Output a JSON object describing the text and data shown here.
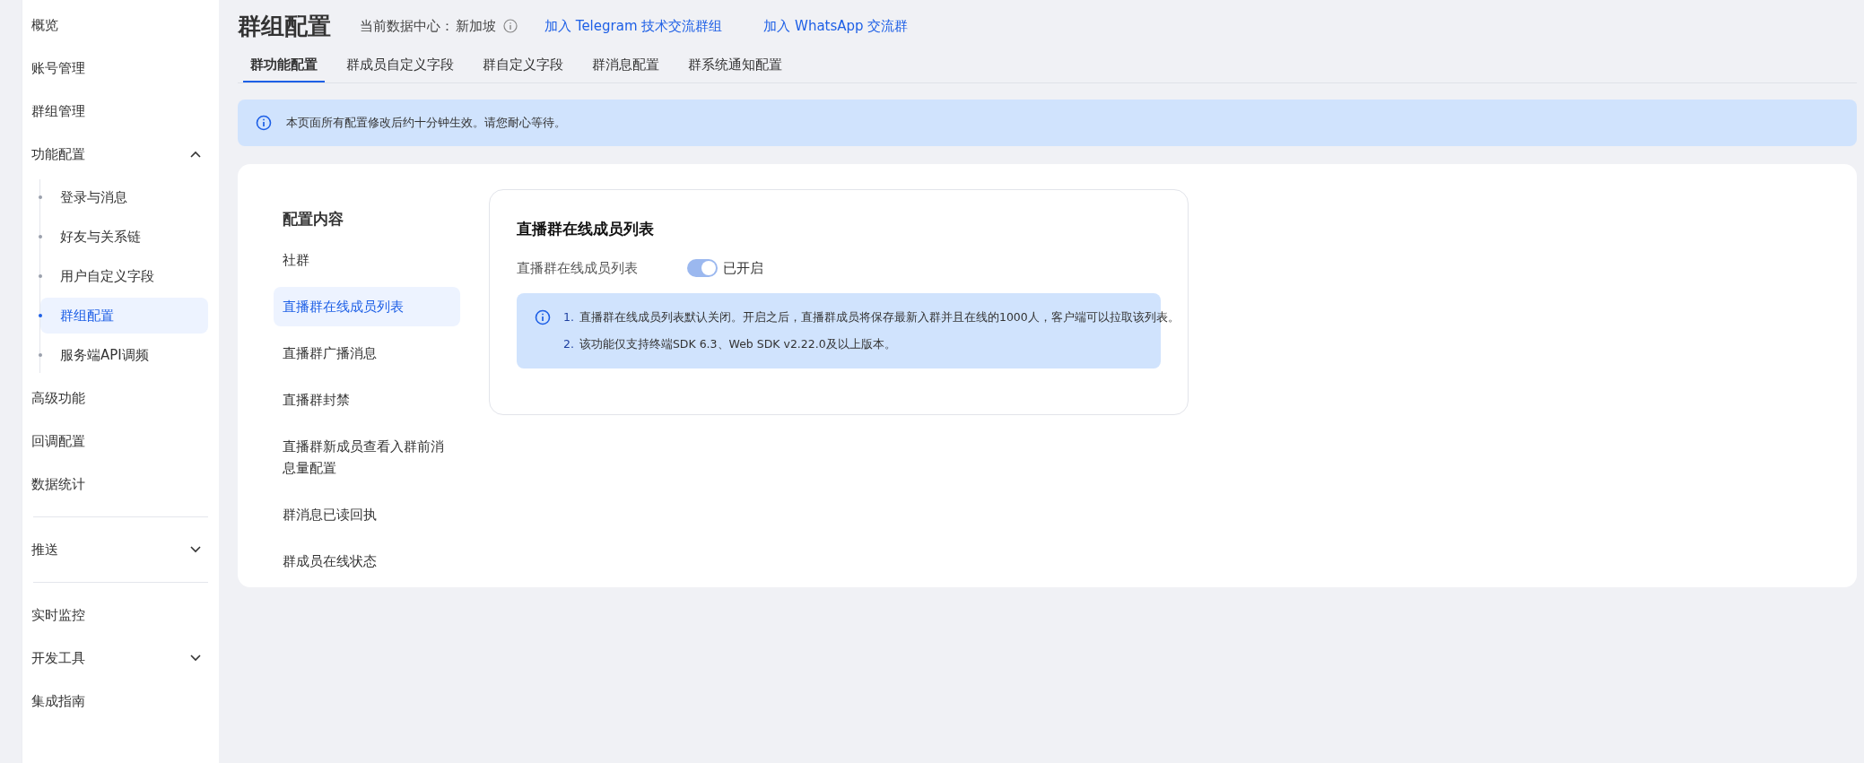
{
  "sidebar": {
    "groups": [
      {
        "items": [
          {
            "label": "概览",
            "selected": false
          },
          {
            "label": "账号管理",
            "selected": false
          },
          {
            "label": "群组管理",
            "selected": false
          },
          {
            "label": "功能配置",
            "selected": false,
            "expanded": true,
            "children": [
              {
                "label": "登录与消息",
                "selected": false
              },
              {
                "label": "好友与关系链",
                "selected": false
              },
              {
                "label": "用户自定义字段",
                "selected": false
              },
              {
                "label": "群组配置",
                "selected": true
              },
              {
                "label": "服务端API调频",
                "selected": false
              }
            ]
          },
          {
            "label": "高级功能",
            "selected": false
          },
          {
            "label": "回调配置",
            "selected": false
          },
          {
            "label": "数据统计",
            "selected": false
          }
        ]
      },
      {
        "items": [
          {
            "label": "推送",
            "selected": false,
            "expanded": false
          }
        ]
      },
      {
        "items": [
          {
            "label": "实时监控",
            "selected": false
          },
          {
            "label": "开发工具",
            "selected": false,
            "expanded": false
          },
          {
            "label": "集成指南",
            "selected": false
          }
        ]
      }
    ]
  },
  "header": {
    "title": "群组配置",
    "datacenter_label": "当前数据中心：",
    "datacenter_value": "新加坡",
    "links": [
      "加入 Telegram 技术交流群组",
      "加入 WhatsApp 交流群"
    ]
  },
  "tabs": [
    {
      "label": "群功能配置",
      "selected": true
    },
    {
      "label": "群成员自定义字段",
      "selected": false
    },
    {
      "label": "群自定义字段",
      "selected": false
    },
    {
      "label": "群消息配置",
      "selected": false
    },
    {
      "label": "群系统通知配置",
      "selected": false
    }
  ],
  "notice": "本页面所有配置修改后约十分钟生效。请您耐心等待。",
  "config_nav": {
    "title": "配置内容",
    "items": [
      {
        "label": "社群",
        "selected": false
      },
      {
        "label": "直播群在线成员列表",
        "selected": true
      },
      {
        "label": "直播群广播消息",
        "selected": false
      },
      {
        "label": "直播群封禁",
        "selected": false
      },
      {
        "label": "直播群新成员查看入群前消息量配置",
        "selected": false
      },
      {
        "label": "群消息已读回执",
        "selected": false
      },
      {
        "label": "群成员在线状态",
        "selected": false
      }
    ]
  },
  "detail": {
    "title": "直播群在线成员列表",
    "setting": {
      "label": "直播群在线成员列表",
      "on": true,
      "status": "已开启"
    },
    "tips": [
      {
        "number": "1.",
        "text": "直播群在线成员列表默认关闭。开启之后，直播群成员将保存最新入群并且在线的1000人，客户端可以拉取该列表。"
      },
      {
        "number": "2.",
        "text": "该功能仅支持终端SDK 6.3、Web SDK v2.22.0及以上版本。"
      }
    ]
  }
}
